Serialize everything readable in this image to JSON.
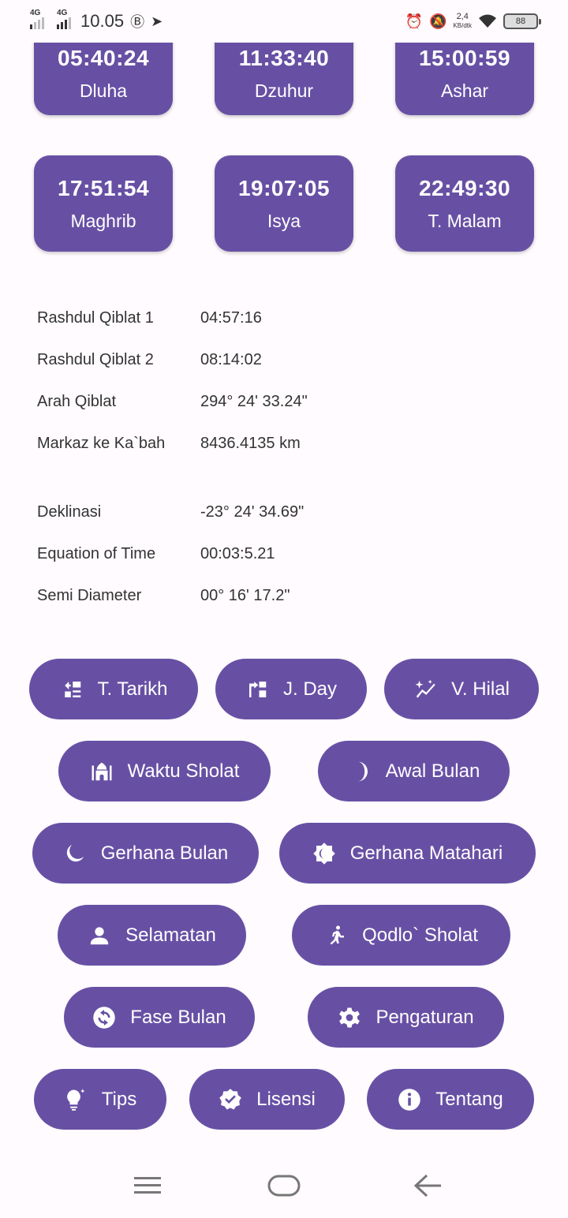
{
  "status_bar": {
    "net1": "4G",
    "net2": "4G",
    "time": "10.05",
    "speed": "2,4",
    "speed_unit": "KB/dtk",
    "battery": "88"
  },
  "prayer_times": [
    {
      "time": "05:40:24",
      "name": "Dluha"
    },
    {
      "time": "11:33:40",
      "name": "Dzuhur"
    },
    {
      "time": "15:00:59",
      "name": "Ashar"
    },
    {
      "time": "17:51:54",
      "name": "Maghrib"
    },
    {
      "time": "19:07:05",
      "name": "Isya"
    },
    {
      "time": "22:49:30",
      "name": "T. Malam"
    }
  ],
  "info": [
    {
      "label": "Rashdul Qiblat 1",
      "value": "04:57:16"
    },
    {
      "label": "Rashdul Qiblat 2",
      "value": "08:14:02"
    },
    {
      "label": "Arah Qiblat",
      "value": "294° 24' 33.24\""
    },
    {
      "label": "Markaz ke Ka`bah",
      "value": "8436.4135 km"
    },
    {
      "label": "Deklinasi",
      "value": "-23° 24' 34.69\""
    },
    {
      "label": "Equation of Time",
      "value": "00:03:5.21"
    },
    {
      "label": "Semi Diameter",
      "value": "00° 16' 17.2\""
    }
  ],
  "menu": [
    {
      "label": "T. Tarikh",
      "icon": "date-convert-icon"
    },
    {
      "label": "J. Day",
      "icon": "julian-day-icon"
    },
    {
      "label": "V. Hilal",
      "icon": "sparkle-chart-icon"
    },
    {
      "label": "Waktu Sholat",
      "icon": "mosque-icon"
    },
    {
      "label": "Awal Bulan",
      "icon": "crescent-icon"
    },
    {
      "label": "Gerhana Bulan",
      "icon": "moon-stars-icon"
    },
    {
      "label": "Gerhana Matahari",
      "icon": "sun-eclipse-icon"
    },
    {
      "label": "Selamatan",
      "icon": "person-icon"
    },
    {
      "label": "Qodlo` Sholat",
      "icon": "running-person-icon"
    },
    {
      "label": "Fase Bulan",
      "icon": "cycle-icon"
    },
    {
      "label": "Pengaturan",
      "icon": "gear-icon"
    },
    {
      "label": "Tips",
      "icon": "lightbulb-icon"
    },
    {
      "label": "Lisensi",
      "icon": "verified-badge-icon"
    },
    {
      "label": "Tentang",
      "icon": "info-icon"
    }
  ],
  "colors": {
    "accent": "#6750a4",
    "background": "#fffbfe"
  }
}
